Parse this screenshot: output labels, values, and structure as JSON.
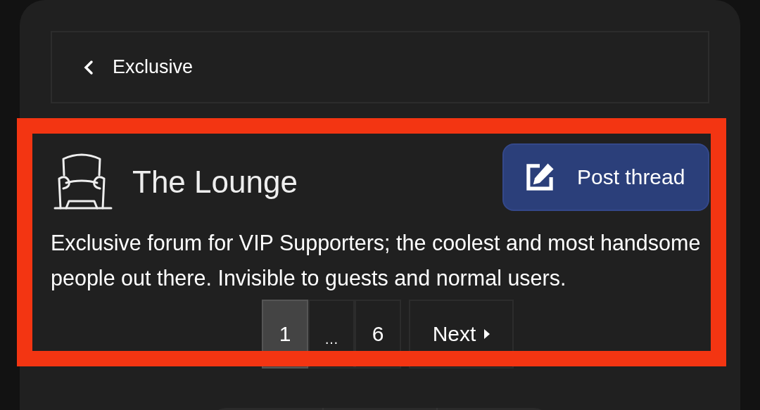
{
  "breadcrumb": {
    "label": "Exclusive"
  },
  "forum": {
    "title": "The Lounge",
    "description": "Exclusive forum for VIP Supporters; the coolest and most handsome people out there. Invisible to guests and normal users."
  },
  "post_button": {
    "label": "Post thread"
  },
  "pagination": {
    "pages": [
      {
        "kind": "page",
        "label": "1",
        "selected": true
      },
      {
        "kind": "ellipsis",
        "label": "…",
        "selected": false
      },
      {
        "kind": "page",
        "label": "6",
        "selected": false
      }
    ],
    "next": "Next"
  }
}
